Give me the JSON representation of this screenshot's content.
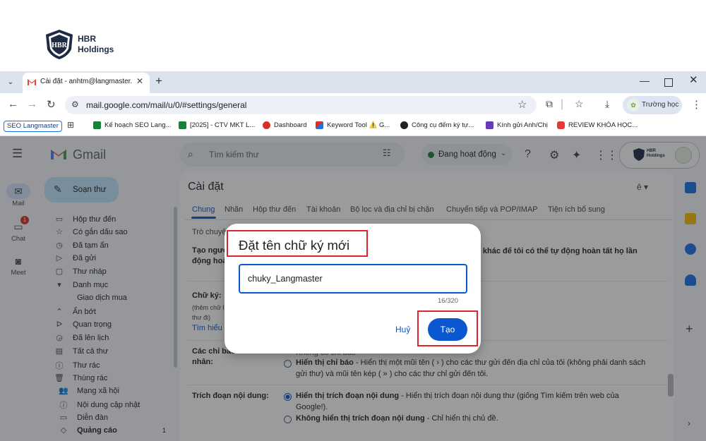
{
  "brand": {
    "name": "HBR\nHoldings",
    "logo_letters": "HBR"
  },
  "browser": {
    "tab_title": "Cài đặt - anhtm@langmaster.edu.vn",
    "url": "mail.google.com/mail/u/0/#settings/general",
    "profile_name": "Trường học",
    "new_tab_symbol": "+",
    "tab_close_symbol": "✕",
    "bookmarks": [
      {
        "label": "Kế hoạch SEO Lang...",
        "color": "#188038"
      },
      {
        "label": "[2025] - CTV MKT L...",
        "color": "#188038"
      },
      {
        "label": "Dashboard",
        "color": "#d93025"
      },
      {
        "label": "Keyword Tool ⚠️ G...",
        "color": "#d93025"
      },
      {
        "label": "Công cụ đếm ký tự...",
        "color": "#202124"
      },
      {
        "label": "Kính gửi Anh/Chị",
        "color": "#673ab7"
      },
      {
        "label": "REVIEW KHÓA HỌC...",
        "color": "#e53935"
      }
    ],
    "bookmark_seo": "SEO Langmaster"
  },
  "gmail": {
    "app_name": "Gmail",
    "compose_label": "Soạn thư",
    "search_placeholder": "Tìm kiếm thư",
    "status_label": "Đang hoạt động",
    "account_text": "HBR\nHoldings",
    "rail": [
      {
        "label": "Mail",
        "icon": "mail-icon"
      },
      {
        "label": "Chat",
        "icon": "chat-icon",
        "badge": "1"
      },
      {
        "label": "Meet",
        "icon": "video-icon"
      }
    ],
    "nav": [
      {
        "label": "Hộp thư đến",
        "icon": "inbox-icon",
        "glyph": "▭"
      },
      {
        "label": "Có gắn dấu sao",
        "icon": "star-icon",
        "glyph": "☆"
      },
      {
        "label": "Đã tạm ẩn",
        "icon": "clock-icon",
        "glyph": "◷"
      },
      {
        "label": "Đã gửi",
        "icon": "send-icon",
        "glyph": "▷"
      },
      {
        "label": "Thư nháp",
        "icon": "draft-icon",
        "glyph": "▢"
      },
      {
        "label": "Danh mục",
        "icon": "label-icon",
        "glyph": "▾"
      },
      {
        "label": "Giao dịch mua",
        "icon": "tag-icon",
        "glyph": ""
      },
      {
        "label": "Ẩn bớt",
        "icon": "chevron-up-icon",
        "glyph": "⌃"
      },
      {
        "label": "Quan trọng",
        "icon": "important-icon",
        "glyph": "ᐅ"
      },
      {
        "label": "Đã lên lịch",
        "icon": "scheduled-icon",
        "glyph": "◶"
      },
      {
        "label": "Tất cả thư",
        "icon": "all-mail-icon",
        "glyph": "▤"
      },
      {
        "label": "Thư rác",
        "icon": "spam-icon",
        "glyph": "ⓘ"
      },
      {
        "label": "Thùng rác",
        "icon": "trash-icon",
        "glyph": "🗑"
      },
      {
        "label": "Mạng xã hội",
        "icon": "people-icon",
        "glyph": "👥"
      },
      {
        "label": "Nội dung cập nhật",
        "icon": "info-icon",
        "glyph": "ⓘ"
      },
      {
        "label": "Diễn đàn",
        "icon": "forum-icon",
        "glyph": "▭"
      },
      {
        "label": "Quảng cáo",
        "icon": "promo-icon",
        "glyph": "◇",
        "count": "1"
      }
    ]
  },
  "settings": {
    "title": "Cài đặt",
    "lang_chip": "ê",
    "tabs": [
      "Chung",
      "Nhãn",
      "Hộp thư đến",
      "Tài khoản",
      "Bộ lọc và địa chỉ bị chặn",
      "Chuyển tiếp và POP/IMAP",
      "Tiện ích bổ sung"
    ],
    "subtab": "Trò chuyệ",
    "rows": {
      "contacts_label": "Tạo người\nđộng hoà",
      "contacts_text": "ọa khác để tôi có thể tự động hoàn tất họ lần",
      "signature_label": "Chữ ký:",
      "signature_sub": "(thêm chữ l\nthư đi)",
      "signature_link": "Tìm hiểu t",
      "indicators_label": "Các chỉ báo\nnhân:",
      "indicators_opt1_hint": "Không có chỉ báo",
      "indicators_opt2": "Hiển thị chỉ báo",
      "indicators_opt2_desc": " - Hiển thị một mũi tên ( › ) cho các thư gửi đến địa chỉ của tôi (không phải danh sách",
      "indicators_opt2_desc2": "gửi thư) và mũi tên kép ( » ) cho các thư chỉ gửi đến tôi.",
      "snippets_label": "Trích đoạn nội dung:",
      "snippets_opt1": "Hiển thị trích đoạn nội dung",
      "snippets_opt1_desc": " - Hiển thị trích đoạn nội dung thư (giống Tìm kiếm trên web của",
      "snippets_opt1_desc2": "Google!).",
      "snippets_opt2": "Không hiển thị trích đoạn nội dung",
      "snippets_opt2_desc": " - Chỉ hiển thị chủ đề."
    }
  },
  "dialog": {
    "title": "Đặt tên chữ ký mới",
    "input_value": "chuky_Langmaster",
    "char_count": "16/320",
    "cancel_label": "Huỷ",
    "create_label": "Tạo"
  },
  "colors": {
    "gmail_blue": "#0b57d0",
    "highlight_red": "#e0242b",
    "status_green": "#188038"
  }
}
